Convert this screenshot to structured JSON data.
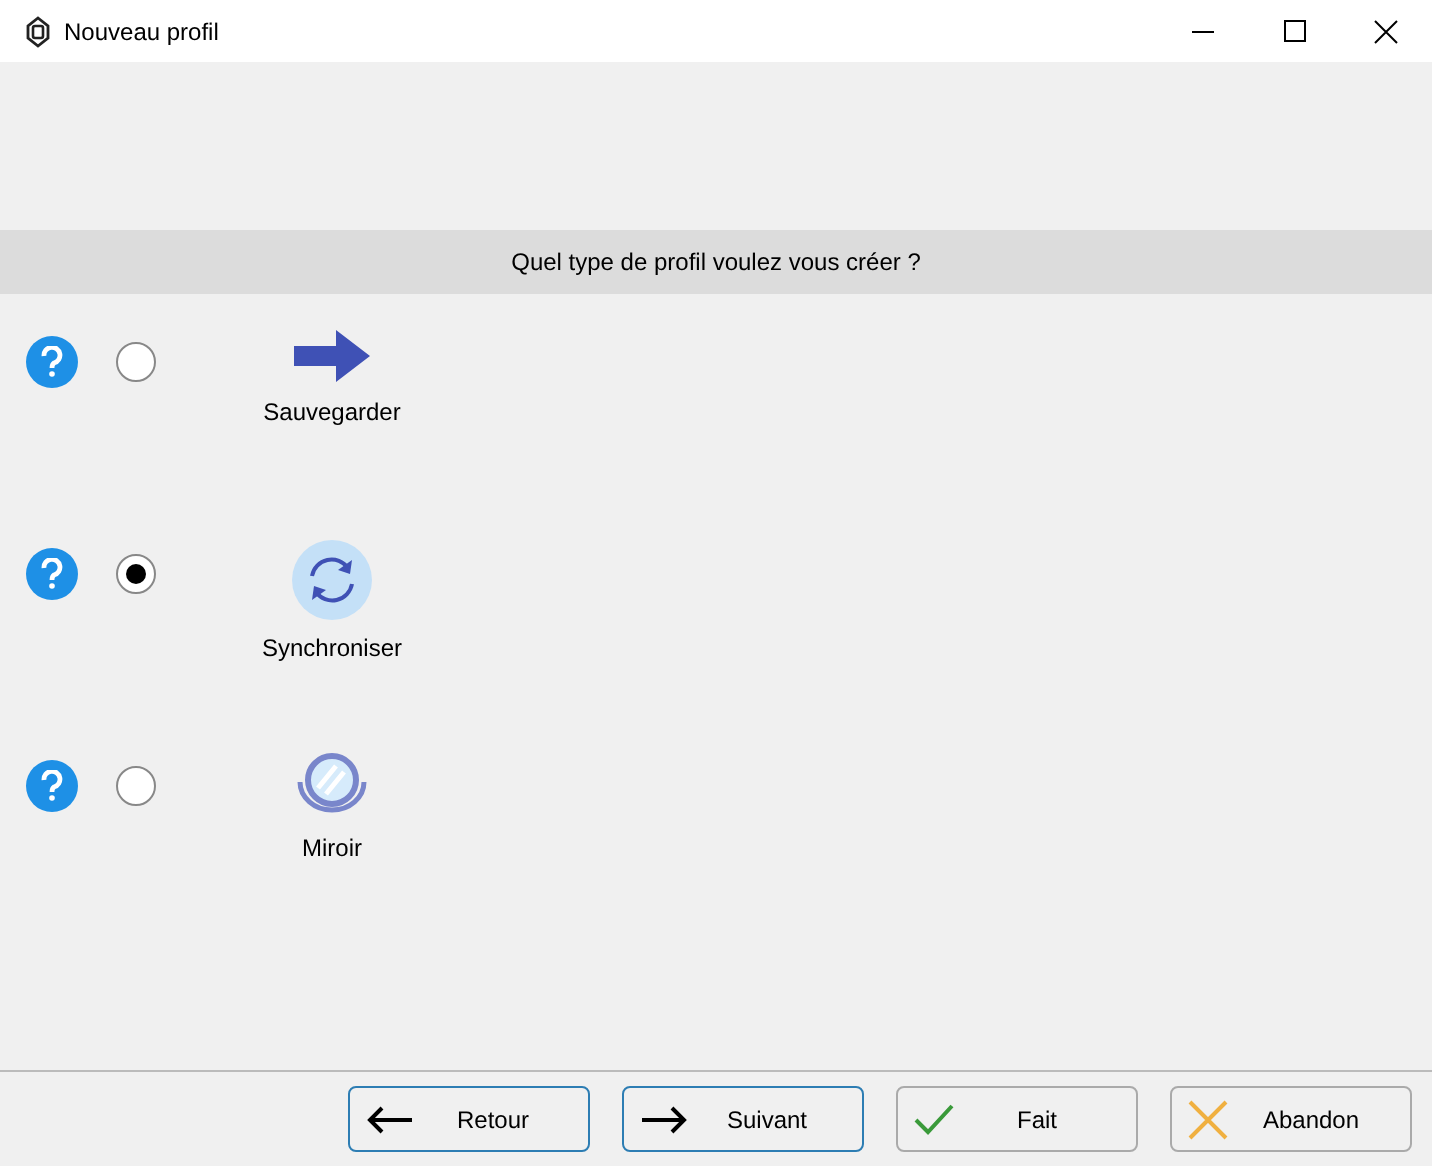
{
  "window": {
    "title": "Nouveau profil"
  },
  "question": "Quel type de profil voulez vous créer ?",
  "options": [
    {
      "kind": "arrow",
      "label": "Sauvegarder",
      "selected": false
    },
    {
      "kind": "sync",
      "label": "Synchroniser",
      "selected": true
    },
    {
      "kind": "mirror",
      "label": "Miroir",
      "selected": false
    }
  ],
  "buttons": [
    {
      "kind": "back",
      "label": "Retour",
      "accented": true
    },
    {
      "kind": "next",
      "label": "Suivant",
      "accented": true
    },
    {
      "kind": "done",
      "label": "Fait",
      "accented": false
    },
    {
      "kind": "cancel",
      "label": "Abandon",
      "accented": false
    }
  ]
}
